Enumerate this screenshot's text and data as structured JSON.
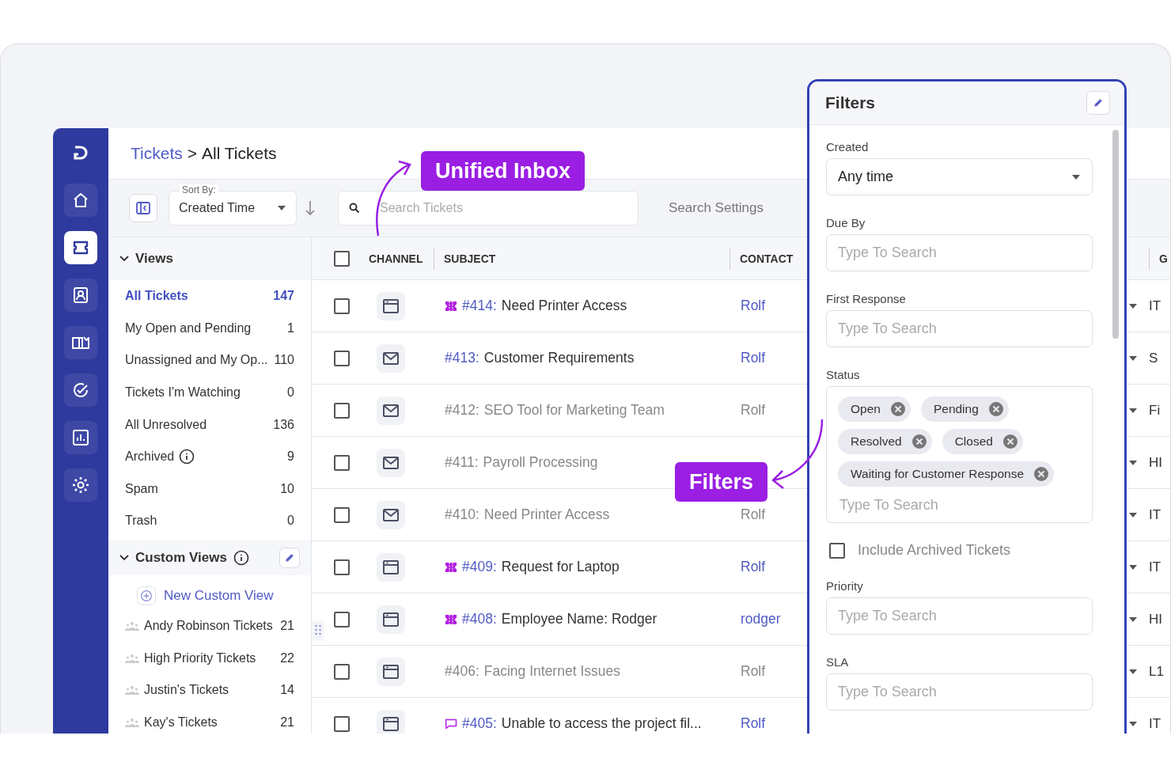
{
  "nav": [
    {
      "selected": false
    },
    {
      "selected": false
    },
    {
      "selected": true
    },
    {
      "selected": false
    },
    {
      "selected": false
    },
    {
      "selected": false
    },
    {
      "selected": false
    },
    {
      "selected": false
    }
  ],
  "breadcrumb": {
    "link": "Tickets",
    "separator": ">",
    "current": "All Tickets"
  },
  "toolbar": {
    "sort_label": "Sort By:",
    "sort_value": "Created Time",
    "search_placeholder": "Search Tickets",
    "search_settings": "Search Settings"
  },
  "views": {
    "title": "Views",
    "expanded": true,
    "items": [
      {
        "label": "All Tickets",
        "count": "147",
        "selected": true,
        "info": false
      },
      {
        "label": "My Open and Pending",
        "count": "1",
        "selected": false,
        "info": false
      },
      {
        "label": "Unassigned and My Op...",
        "count": "110",
        "selected": false,
        "info": false
      },
      {
        "label": "Tickets I'm Watching",
        "count": "0",
        "selected": false,
        "info": false
      },
      {
        "label": "All Unresolved",
        "count": "136",
        "selected": false,
        "info": false
      },
      {
        "label": "Archived",
        "count": "9",
        "selected": false,
        "info": true
      },
      {
        "label": "Spam",
        "count": "10",
        "selected": false,
        "info": false
      },
      {
        "label": "Trash",
        "count": "0",
        "selected": false,
        "info": false
      }
    ]
  },
  "custom_views": {
    "title": "Custom Views",
    "expanded": true,
    "new_label": "New Custom View",
    "items": [
      {
        "label": "Andy Robinson Tickets",
        "count": "21"
      },
      {
        "label": "High Priority Tickets",
        "count": "22"
      },
      {
        "label": "Justin's Tickets",
        "count": "14"
      },
      {
        "label": "Kay's Tickets",
        "count": "21"
      }
    ]
  },
  "table": {
    "columns": [
      "CHANNEL",
      "SUBJECT",
      "CONTACT",
      "G"
    ],
    "all_checked": false,
    "rows": [
      {
        "checked": false,
        "kind": "portal",
        "marker": {
          "kind": "ticket"
        },
        "number": "#414:",
        "title": "Need Printer Access",
        "unread": true,
        "contact": "Rolf",
        "group": "IT"
      },
      {
        "checked": false,
        "kind": "email",
        "number": "#413:",
        "title": "Customer Requirements",
        "unread": true,
        "contact": "Rolf",
        "group": "S"
      },
      {
        "checked": false,
        "kind": "email",
        "number": "#412:",
        "title": "SEO Tool for Marketing Team",
        "unread": false,
        "contact": "Rolf",
        "group": "Fi"
      },
      {
        "checked": false,
        "kind": "email",
        "number": "#411:",
        "title": "Payroll Processing",
        "unread": false,
        "group": "HI"
      },
      {
        "checked": false,
        "kind": "email",
        "number": "#410:",
        "title": "Need Printer Access",
        "unread": false,
        "contact": "Rolf",
        "group": "IT"
      },
      {
        "checked": false,
        "kind": "portal",
        "marker": {
          "kind": "ticket"
        },
        "number": "#409:",
        "title": "Request for Laptop",
        "unread": true,
        "contact": "Rolf",
        "group": "IT"
      },
      {
        "checked": false,
        "kind": "portal",
        "marker": {
          "kind": "ticket"
        },
        "number": "#408:",
        "title": "Employee Name: Rodger",
        "unread": true,
        "contact": "rodger",
        "group": "HI"
      },
      {
        "checked": false,
        "kind": "portal",
        "number": "#406:",
        "title": "Facing Internet Issues",
        "unread": false,
        "contact": "Rolf",
        "group": "L1"
      },
      {
        "checked": false,
        "kind": "portal",
        "marker": {
          "kind": "chat"
        },
        "number": "#405:",
        "title": "Unable to access the project fil...",
        "unread": true,
        "contact": "Rolf",
        "group": "IT"
      }
    ]
  },
  "filters": {
    "title": "Filters",
    "fields": [
      {
        "kind": "select",
        "label": "Created",
        "value": "Any time"
      },
      {
        "kind": "text",
        "label": "Due By",
        "placeholder": "Type To Search"
      },
      {
        "kind": "text",
        "label": "First Response",
        "placeholder": "Type To Search"
      },
      {
        "kind": "tags",
        "label": "Status",
        "tags": [
          "Open",
          "Pending",
          "Resolved",
          "Closed",
          "Waiting for Customer Response"
        ],
        "placeholder": "Type To Search"
      },
      {
        "kind": "checkbox",
        "label": "Include Archived Tickets",
        "checked": false
      },
      {
        "kind": "text",
        "label": "Priority",
        "placeholder": "Type To Search"
      },
      {
        "kind": "text",
        "label": "SLA",
        "placeholder": "Type To Search"
      }
    ]
  },
  "callouts": [
    {
      "label": "Unified Inbox"
    },
    {
      "label": "Filters"
    }
  ]
}
